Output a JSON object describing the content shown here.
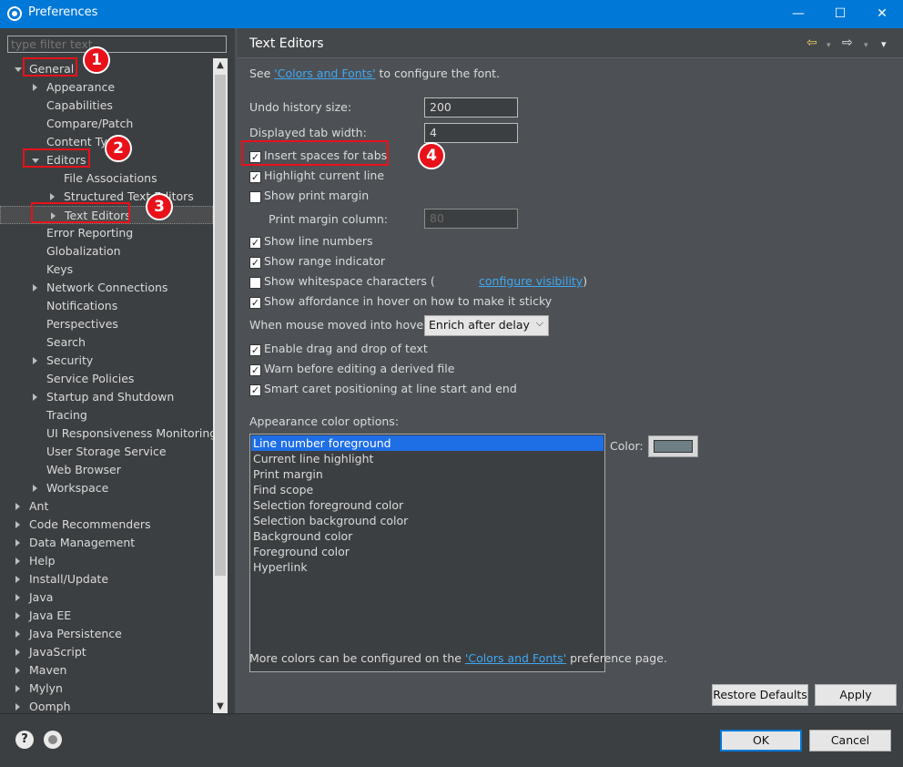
{
  "window": {
    "title": "Preferences",
    "buttons": {
      "minimize": "—",
      "maximize": "☐",
      "close": "✕"
    }
  },
  "filter": {
    "placeholder": "type filter text"
  },
  "tree": [
    {
      "label": "General",
      "level": 0,
      "expand": "open"
    },
    {
      "label": "Appearance",
      "level": 1,
      "expand": "closed"
    },
    {
      "label": "Capabilities",
      "level": 1,
      "expand": "none"
    },
    {
      "label": "Compare/Patch",
      "level": 1,
      "expand": "none"
    },
    {
      "label": "Content Types",
      "level": 1,
      "expand": "none"
    },
    {
      "label": "Editors",
      "level": 1,
      "expand": "open"
    },
    {
      "label": "File Associations",
      "level": 2,
      "expand": "none"
    },
    {
      "label": "Structured Text Editors",
      "level": 2,
      "expand": "closed"
    },
    {
      "label": "Text Editors",
      "level": 2,
      "expand": "closed",
      "selected": true
    },
    {
      "label": "Error Reporting",
      "level": 1,
      "expand": "none"
    },
    {
      "label": "Globalization",
      "level": 1,
      "expand": "none"
    },
    {
      "label": "Keys",
      "level": 1,
      "expand": "none"
    },
    {
      "label": "Network Connections",
      "level": 1,
      "expand": "closed"
    },
    {
      "label": "Notifications",
      "level": 1,
      "expand": "none"
    },
    {
      "label": "Perspectives",
      "level": 1,
      "expand": "none"
    },
    {
      "label": "Search",
      "level": 1,
      "expand": "none"
    },
    {
      "label": "Security",
      "level": 1,
      "expand": "closed"
    },
    {
      "label": "Service Policies",
      "level": 1,
      "expand": "none"
    },
    {
      "label": "Startup and Shutdown",
      "level": 1,
      "expand": "closed"
    },
    {
      "label": "Tracing",
      "level": 1,
      "expand": "none"
    },
    {
      "label": "UI Responsiveness Monitoring",
      "level": 1,
      "expand": "none"
    },
    {
      "label": "User Storage Service",
      "level": 1,
      "expand": "none"
    },
    {
      "label": "Web Browser",
      "level": 1,
      "expand": "none"
    },
    {
      "label": "Workspace",
      "level": 1,
      "expand": "closed"
    },
    {
      "label": "Ant",
      "level": 0,
      "expand": "closed"
    },
    {
      "label": "Code Recommenders",
      "level": 0,
      "expand": "closed"
    },
    {
      "label": "Data Management",
      "level": 0,
      "expand": "closed"
    },
    {
      "label": "Help",
      "level": 0,
      "expand": "closed"
    },
    {
      "label": "Install/Update",
      "level": 0,
      "expand": "closed"
    },
    {
      "label": "Java",
      "level": 0,
      "expand": "closed"
    },
    {
      "label": "Java EE",
      "level": 0,
      "expand": "closed"
    },
    {
      "label": "Java Persistence",
      "level": 0,
      "expand": "closed"
    },
    {
      "label": "JavaScript",
      "level": 0,
      "expand": "closed"
    },
    {
      "label": "Maven",
      "level": 0,
      "expand": "closed"
    },
    {
      "label": "Mylyn",
      "level": 0,
      "expand": "closed"
    },
    {
      "label": "Oomph",
      "level": 0,
      "expand": "closed"
    }
  ],
  "annotations": [
    "1",
    "2",
    "3",
    "4"
  ],
  "page": {
    "title": "Text Editors",
    "nav": {
      "back": "⇦",
      "forward": "⇨",
      "menu": "▾"
    },
    "font_note": {
      "pre": "See ",
      "link": "'Colors and Fonts'",
      "post": " to configure the font."
    },
    "undo_label": "Undo history size:",
    "undo_value": "200",
    "tab_label": "Displayed tab width:",
    "tab_value": "4",
    "checks": [
      {
        "label": "Insert spaces for tabs",
        "checked": true
      },
      {
        "label": "Highlight current line",
        "checked": true
      },
      {
        "label": "Show print margin",
        "checked": false
      },
      {
        "label": "Show line numbers",
        "checked": true
      },
      {
        "label": "Show range indicator",
        "checked": true
      },
      {
        "label": "Show whitespace characters (",
        "checked": false
      },
      {
        "label": "Show affordance in hover on how to make it sticky",
        "checked": true
      },
      {
        "label": "Enable drag and drop of text",
        "checked": true
      },
      {
        "label": "Warn before editing a derived file",
        "checked": true
      },
      {
        "label": "Smart caret positioning at line start and end",
        "checked": true
      }
    ],
    "whitespace_link": "configure visibility",
    "whitespace_close": ")",
    "print_margin_label": "Print margin column:",
    "print_margin_value": "80",
    "hover_label": "When mouse moved into hover:",
    "hover_value": "Enrich after delay",
    "appearance_label": "Appearance color options:",
    "color_items": [
      "Line number foreground",
      "Current line highlight",
      "Print margin",
      "Find scope",
      "Selection foreground color",
      "Selection background color",
      "Background color",
      "Foreground color",
      "Hyperlink"
    ],
    "color_label": "Color:",
    "color_value": "#6e8086",
    "more_colors": {
      "pre": "More colors can be configured on the ",
      "link": "'Colors and Fonts'",
      "post": " preference page."
    },
    "restore_defaults": "Restore Defaults",
    "apply": "Apply"
  },
  "footer": {
    "help": "?",
    "ok": "OK",
    "cancel": "Cancel"
  },
  "colors": {
    "accent": "#0078d7",
    "highlight": "#e8111a",
    "selection": "#1e6ee6",
    "link": "#3fa8f2"
  }
}
